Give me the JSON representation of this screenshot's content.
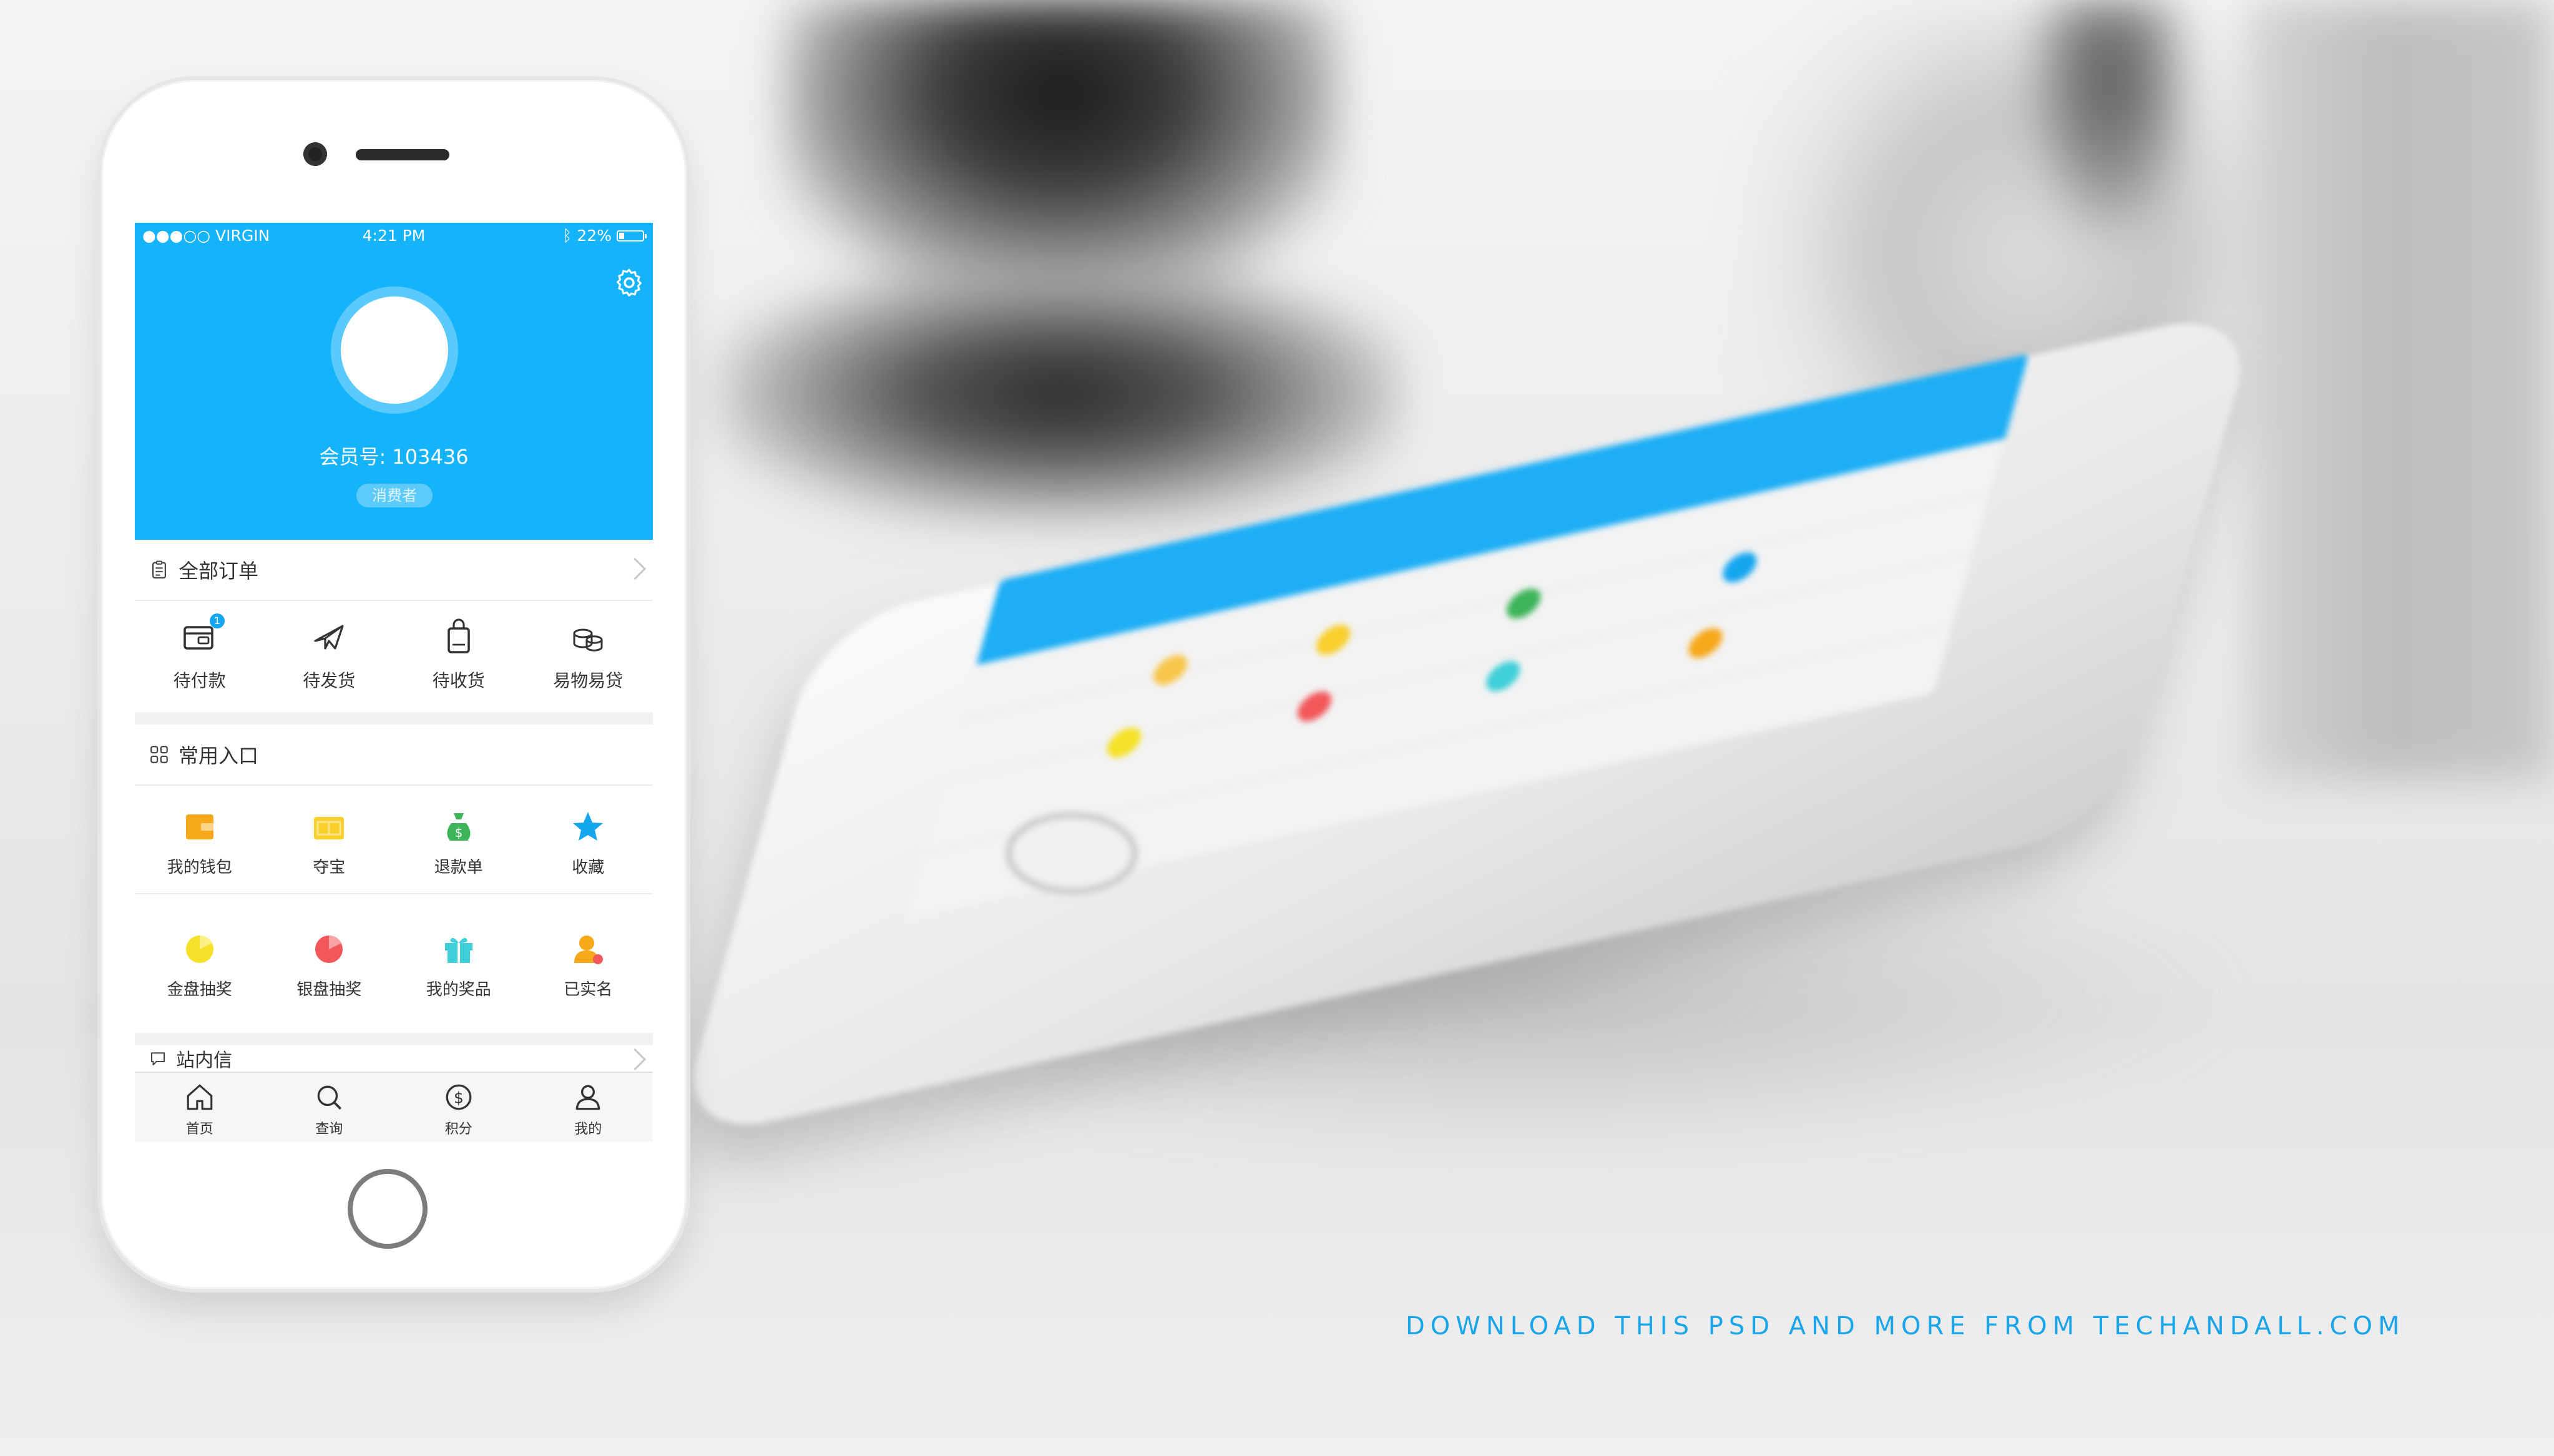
{
  "status_bar": {
    "carrier": "●●●○○ VIRGIN",
    "time": "4:21 PM",
    "battery": "22%"
  },
  "profile": {
    "member_id": "会员号: 103436",
    "role_tag": "消费者"
  },
  "orders": {
    "title": "全部订单",
    "badge_count": "1",
    "items": [
      {
        "label": "待付款",
        "icon": "wallet-card-icon"
      },
      {
        "label": "待发货",
        "icon": "airplane-icon"
      },
      {
        "label": "待收货",
        "icon": "shopping-bag-icon"
      },
      {
        "label": "易物易贷",
        "icon": "coins-stack-icon"
      }
    ]
  },
  "shortcuts": {
    "title": "常用入口",
    "row1": [
      {
        "label": "我的钱包",
        "icon": "wallet-icon",
        "color": "#f7a81b"
      },
      {
        "label": "夺宝",
        "icon": "treasure-icon",
        "color": "#f8cf2b"
      },
      {
        "label": "退款单",
        "icon": "money-bag-icon",
        "color": "#3cb45a"
      },
      {
        "label": "收藏",
        "icon": "star-icon",
        "color": "#15a6f0"
      }
    ],
    "row2": [
      {
        "label": "金盘抽奖",
        "icon": "gold-wheel-icon",
        "color": "#f6e128"
      },
      {
        "label": "银盘抽奖",
        "icon": "silver-wheel-icon",
        "color": "#f2585a"
      },
      {
        "label": "我的奖品",
        "icon": "gift-icon",
        "color": "#3ecfd8"
      },
      {
        "label": "已实名",
        "icon": "verified-user-icon",
        "color": "#f7a81b"
      }
    ]
  },
  "messages": {
    "title": "站内信"
  },
  "tabbar": [
    {
      "label": "首页",
      "icon": "home-icon"
    },
    {
      "label": "查询",
      "icon": "search-icon"
    },
    {
      "label": "积分",
      "icon": "dollar-coin-icon"
    },
    {
      "label": "我的",
      "icon": "user-icon"
    }
  ],
  "promo_text": "DOWNLOAD THIS PSD AND MORE FROM TECHANDALL.COM",
  "colors": {
    "header_blue": "#15b3fa",
    "promo_blue": "#1aa5e8"
  }
}
